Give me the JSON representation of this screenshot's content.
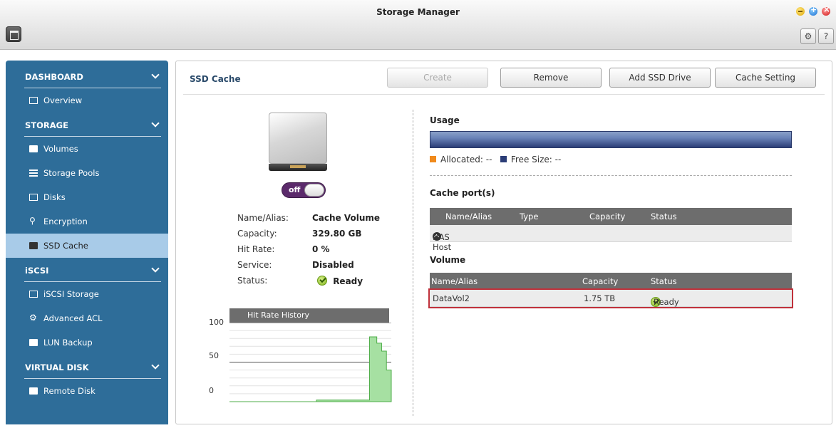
{
  "window": {
    "title": "Storage Manager"
  },
  "toolbar_icons": [
    "app-menu-icon",
    "minimize-icon",
    "maximize-icon",
    "close-icon",
    "gear-icon",
    "help-icon"
  ],
  "toolbar": {
    "help_label": "?"
  },
  "sidebar": {
    "groups": [
      {
        "label": "DASHBOARD",
        "items": [
          {
            "label": "Overview",
            "icon": "overview-icon"
          }
        ]
      },
      {
        "label": "STORAGE",
        "items": [
          {
            "label": "Volumes",
            "icon": "volume-icon"
          },
          {
            "label": "Storage Pools",
            "icon": "storage-pool-icon"
          },
          {
            "label": "Disks",
            "icon": "disk-icon"
          },
          {
            "label": "Encryption",
            "icon": "key-icon"
          },
          {
            "label": "SSD Cache",
            "icon": "ssd-cache-icon",
            "active": true
          }
        ]
      },
      {
        "label": "iSCSI",
        "items": [
          {
            "label": "iSCSI Storage",
            "icon": "iscsi-storage-icon"
          },
          {
            "label": "Advanced ACL",
            "icon": "gear-icon"
          },
          {
            "label": "LUN Backup",
            "icon": "lun-backup-icon"
          }
        ]
      },
      {
        "label": "VIRTUAL DISK",
        "items": [
          {
            "label": "Remote Disk",
            "icon": "remote-disk-icon"
          }
        ]
      }
    ]
  },
  "main": {
    "title": "SSD Cache",
    "buttons": {
      "create": "Create",
      "remove": "Remove",
      "add_ssd": "Add SSD Drive",
      "cache_setting": "Cache Setting"
    },
    "toggle": {
      "label": "off",
      "state": "off"
    },
    "properties": [
      {
        "key": "Name/Alias:",
        "value": "Cache Volume"
      },
      {
        "key": "Capacity:",
        "value": "329.80 GB"
      },
      {
        "key": "Hit Rate:",
        "value": "0 %"
      },
      {
        "key": "Service:",
        "value": "Disabled"
      },
      {
        "key": "Status:",
        "value": "Ready",
        "icon": "check-icon"
      }
    ],
    "hit_rate": {
      "title": "Hit Rate History",
      "ticks": [
        "100",
        "50",
        "0"
      ]
    },
    "usage": {
      "title": "Usage",
      "allocated_label": "Allocated: --",
      "free_label": "Free Size: --",
      "allocated_color": "#f08a1c",
      "free_color": "#2b3d77"
    },
    "cache_ports": {
      "title": "Cache port(s)",
      "columns": [
        "Name/Alias",
        "Type",
        "Capacity",
        "Status"
      ],
      "rows": [
        {
          "name": "NAS Host",
          "icon": "host-icon"
        }
      ]
    },
    "volume": {
      "title": "Volume",
      "columns": [
        "Name/Alias",
        "Capacity",
        "Status"
      ],
      "rows": [
        {
          "name": "DataVol2",
          "capacity": "1.75 TB",
          "status": "Ready"
        }
      ]
    }
  },
  "chart_data": {
    "type": "area",
    "title": "Hit Rate History",
    "ylim": [
      0,
      100
    ],
    "yticks": [
      100,
      50,
      0
    ],
    "series": [
      {
        "values": [
          0,
          0,
          0,
          0,
          0,
          0,
          0,
          0,
          0,
          0,
          0,
          0,
          0,
          0,
          0,
          0,
          0,
          0,
          0,
          0,
          0,
          0,
          0,
          0,
          0,
          0,
          0,
          0,
          0,
          0,
          0,
          0,
          0,
          0,
          0,
          0,
          2,
          2,
          2,
          2,
          2,
          2,
          2,
          2,
          2,
          2,
          2,
          2,
          2,
          2,
          2,
          2,
          2,
          2,
          2,
          2,
          2,
          2,
          82,
          82,
          82,
          74,
          74,
          64,
          64,
          40,
          40,
          10
        ]
      }
    ]
  }
}
